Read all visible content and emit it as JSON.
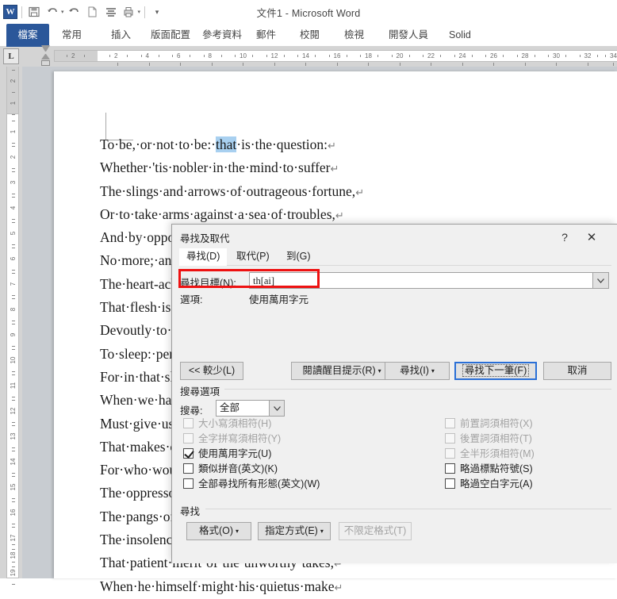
{
  "titlebar": {
    "document_title": "文件1 - Microsoft Word",
    "quick_access": [
      {
        "name": "word-logo-icon",
        "glyph": "W"
      },
      {
        "name": "save-icon",
        "glyph": "🖫"
      },
      {
        "name": "undo-icon",
        "glyph": "↶"
      },
      {
        "name": "redo-icon",
        "glyph": "↺"
      },
      {
        "name": "new-document-icon",
        "glyph": "🗋"
      },
      {
        "name": "paragraph-marks-icon",
        "glyph": "≡"
      },
      {
        "name": "print-preview-icon",
        "glyph": "🖶"
      },
      {
        "name": "customize-qat-icon",
        "glyph": "▾"
      }
    ]
  },
  "ribbon": {
    "tabs": [
      {
        "label": "檔案",
        "active": true
      },
      {
        "label": "常用",
        "active": false
      },
      {
        "label": "插入",
        "active": false
      },
      {
        "label": "版面配置",
        "active": false
      },
      {
        "label": "參考資料",
        "active": false
      },
      {
        "label": "郵件",
        "active": false
      },
      {
        "label": "校閱",
        "active": false
      },
      {
        "label": "檢視",
        "active": false
      },
      {
        "label": "開發人員",
        "active": false
      },
      {
        "label": "Solid",
        "active": false
      }
    ]
  },
  "ruler": {
    "tab_selector_glyph": "L",
    "horizontal_ticks": [
      2,
      2,
      4,
      6,
      8,
      10,
      12,
      14,
      16,
      18,
      20,
      22,
      24,
      26,
      28,
      30,
      32,
      34
    ],
    "vertical_ticks": [
      2,
      1,
      1,
      2,
      3,
      4,
      5,
      6,
      7,
      8,
      9,
      10,
      11,
      12,
      13,
      14,
      15,
      16,
      17,
      18,
      19
    ]
  },
  "document": {
    "lines": [
      {
        "pre": "To·be,·or·not·to·be:·",
        "hl": "that",
        "post": "·is·the·question:",
        "mark": "↵"
      },
      {
        "pre": "Whether·'tis·nobler·in·the·mind·to·suffer",
        "hl": "",
        "post": "",
        "mark": "↵"
      },
      {
        "pre": "The·slings·and·arrows·of·outrageous·fortune,",
        "hl": "",
        "post": "",
        "mark": "↵"
      },
      {
        "pre": "Or·to·take·arms·against·a·sea·of·troubles,",
        "hl": "",
        "post": "",
        "mark": "↵"
      },
      {
        "pre": "And·by·opposing·end·them?·To·die:·to·sleep;",
        "hl": "",
        "post": "",
        "mark": "↵"
      },
      {
        "pre": "No·more;·and·by·a·sleep·to·say·we·end",
        "hl": "",
        "post": "",
        "mark": "↵"
      },
      {
        "pre": "The·heart-ache·and·the·thousand·natural·shocks",
        "hl": "",
        "post": "",
        "mark": "↵"
      },
      {
        "pre": "That·flesh·is·heir·to,·'tis·a·consummation",
        "hl": "",
        "post": "",
        "mark": "↵"
      },
      {
        "pre": "Devoutly·to·be·wish'd.·To·die,·to·sleep;",
        "hl": "",
        "post": "",
        "mark": "↵"
      },
      {
        "pre": "To·sleep:·perchance·to·dream:·ay,·there's·the·rub;",
        "hl": "",
        "post": "",
        "mark": "↵"
      },
      {
        "pre": "For·in·that·sleep·of·death·what·dreams·may·come",
        "hl": "",
        "post": "",
        "mark": "↵"
      },
      {
        "pre": "When·we·have·shuffled·off·this·mortal·coil,",
        "hl": "",
        "post": "",
        "mark": "↵"
      },
      {
        "pre": "Must·give·us·pause:·there's·the·respect",
        "hl": "",
        "post": "",
        "mark": "↵"
      },
      {
        "pre": "That·makes·calamity·of·so·long·life;",
        "hl": "",
        "post": "",
        "mark": "↵"
      },
      {
        "pre": "For·who·would·bear·the·whips·and·scorns·of·time,",
        "hl": "",
        "post": "",
        "mark": "↵"
      },
      {
        "pre": "The·oppressor's·wrong,·the·proud·man's·contumely,",
        "hl": "",
        "post": "",
        "mark": "↵"
      },
      {
        "pre": "The·pangs·of·despised·love,·the·law's·delay,",
        "hl": "",
        "post": "",
        "mark": "↵"
      },
      {
        "pre": "The·insolence·of·office·and·the·spurns",
        "hl": "",
        "post": "",
        "mark": "↵"
      },
      {
        "pre": "That·patient·merit·of·the·unworthy·takes,",
        "hl": "",
        "post": "",
        "mark": "↵"
      },
      {
        "pre": "When·he·himself·might·his·quietus·make",
        "hl": "",
        "post": "",
        "mark": "↵"
      }
    ]
  },
  "dialog": {
    "title": "尋找及取代",
    "help_glyph": "?",
    "close_glyph": "✕",
    "tabs": [
      {
        "label": "尋找(D)",
        "active": true
      },
      {
        "label": "取代(P)",
        "active": false
      },
      {
        "label": "到(G)",
        "active": false
      }
    ],
    "find_what_label": "尋找目標(N):",
    "find_what_value": "th[ai]",
    "find_what_placeholder": "",
    "dropdown_glyph": "⌄",
    "options_label": "選項:",
    "options_value": "使用萬用字元",
    "buttons": {
      "less": "<< 較少(L)",
      "reading_highlight": "閱讀醒目提示(R)",
      "find_in": "尋找(I)",
      "find_next": "尋找下一筆(F)",
      "cancel": "取消"
    },
    "search_options_group": "搜尋選項",
    "search_label": "搜尋:",
    "search_value": "全部",
    "checkboxes_left": [
      {
        "label": "大小寫須相符(H)",
        "checked": false,
        "disabled": true
      },
      {
        "label": "全字拼寫須相符(Y)",
        "checked": false,
        "disabled": true
      },
      {
        "label": "使用萬用字元(U)",
        "checked": true,
        "disabled": false
      },
      {
        "label": "類似拼音(英文)(K)",
        "checked": false,
        "disabled": false
      },
      {
        "label": "全部尋找所有形態(英文)(W)",
        "checked": false,
        "disabled": false
      }
    ],
    "checkboxes_right": [
      {
        "label": "前置詞須相符(X)",
        "checked": false,
        "disabled": true
      },
      {
        "label": "後置詞須相符(T)",
        "checked": false,
        "disabled": true
      },
      {
        "label": "全半形須相符(M)",
        "checked": false,
        "disabled": true
      },
      {
        "label": "略過標點符號(S)",
        "checked": false,
        "disabled": false
      },
      {
        "label": "略過空白字元(A)",
        "checked": false,
        "disabled": false
      }
    ],
    "find_group": "尋找",
    "bottom_buttons": {
      "format": "格式(O)",
      "special": "指定方式(E)",
      "no_formatting": "不限定格式(T)"
    },
    "highlight_color": "#ee1111"
  }
}
